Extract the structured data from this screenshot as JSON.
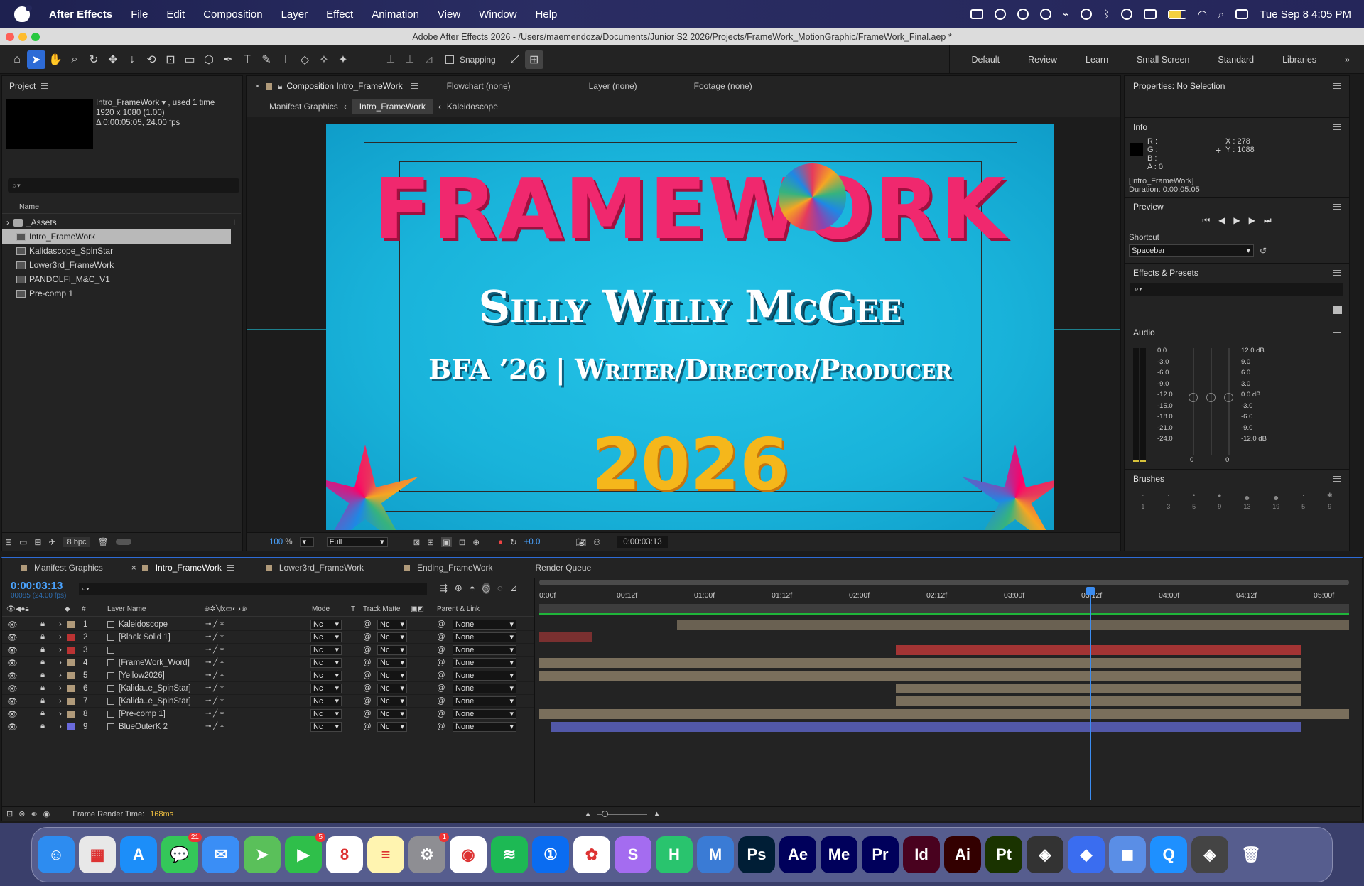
{
  "menubar": {
    "app_name": "After Effects",
    "menus": [
      "File",
      "Edit",
      "Composition",
      "Layer",
      "Effect",
      "Animation",
      "View",
      "Window",
      "Help"
    ],
    "clock": "Tue Sep 8  4:05 PM"
  },
  "titlebar": {
    "title": "Adobe After Effects 2026 - /Users/maemendoza/Documents/Junior S2 2026/Projects/FrameWork_MotionGraphic/FrameWork_Final.aep *"
  },
  "toolbar": {
    "snapping": "Snapping",
    "workspaces": [
      "Default",
      "Review",
      "Learn",
      "Small Screen",
      "Standard",
      "Libraries"
    ]
  },
  "project": {
    "title": "Project",
    "selected_name": "Intro_FrameWork ▾ , used 1 time",
    "selected_dims": "1920 x 1080 (1.00)",
    "selected_dur": "Δ 0:00:05:05, 24.00 fps",
    "col_name": "Name",
    "items": [
      {
        "name": "_Assets",
        "kind": "folder"
      },
      {
        "name": "Intro_FrameWork",
        "kind": "comp"
      },
      {
        "name": "Kalidascope_SpinStar",
        "kind": "comp"
      },
      {
        "name": "Lower3rd_FrameWork",
        "kind": "comp"
      },
      {
        "name": "PANDOLFI_M&C_V1",
        "kind": "comp"
      },
      {
        "name": "Pre-comp 1",
        "kind": "comp"
      }
    ],
    "bpc": "8 bpc"
  },
  "viewer": {
    "tab_comp": "Composition Intro_FrameWork",
    "tab_flowchart": "Flowchart (none)",
    "tab_layer": "Layer (none)",
    "tab_footage": "Footage (none)",
    "crumbs": [
      "Manifest Graphics",
      "Intro_FrameWork",
      "Kaleidoscope"
    ],
    "zoom": "100",
    "zoom_unit": "%",
    "resolution": "Full",
    "exposure": "+0.0",
    "timecode": "0:00:03:13",
    "canvas": {
      "title": "FRAMEWORK",
      "name": "Silly Willy McGee",
      "subtitle": "BFA ’26 | Writer/Director/Producer",
      "year": "2026"
    }
  },
  "right": {
    "properties": "Properties: No Selection",
    "info_title": "Info",
    "info_r": "R :",
    "info_g": "G :",
    "info_b": "B :",
    "info_a": "A :  0",
    "info_x": "X : 278",
    "info_y": "Y : 1088",
    "info_comp": "[Intro_FrameWork]",
    "info_dur": "Duration: 0:00:05:05",
    "preview_title": "Preview",
    "shortcut_label": "Shortcut",
    "shortcut_value": "Spacebar",
    "effects_title": "Effects & Presets",
    "audio_title": "Audio",
    "audio_left": [
      "0.0",
      "-3.0",
      "-6.0",
      "-9.0",
      "-12.0",
      "-15.0",
      "-18.0",
      "-21.0",
      "-24.0"
    ],
    "audio_right": [
      "12.0 dB",
      "9.0",
      "6.0",
      "3.0",
      "0.0 dB",
      "-3.0",
      "-6.0",
      "-9.0",
      "-12.0 dB"
    ],
    "audio_zero_a": "0",
    "audio_zero_b": "0",
    "brushes_title": "Brushes",
    "brush_sizes": [
      "1",
      "3",
      "5",
      "9",
      "13",
      "19",
      "5",
      "9"
    ]
  },
  "timeline": {
    "tabs": [
      "Manifest Graphics",
      "Intro_FrameWork",
      "Lower3rd_FrameWork",
      "Ending_FrameWork",
      "Render Queue"
    ],
    "timecode": "0:00:03:13",
    "frames": "00085 (24.00 fps)",
    "col_hash": "#",
    "col_layer": "Layer Name",
    "col_mode": "Mode",
    "col_t": "T",
    "col_matte": "Track Matte",
    "col_parent": "Parent & Link",
    "ruler": [
      "0:00f",
      "00:12f",
      "01:00f",
      "01:12f",
      "02:00f",
      "02:12f",
      "03:00f",
      "03:12f",
      "04:00f",
      "04:12f",
      "05:00f"
    ],
    "layers": [
      {
        "num": "1",
        "name": "Kaleidoscope",
        "color": "#b09a7a",
        "mode": "Nc",
        "matte": "Nc",
        "parent": "None",
        "start": 0.17,
        "end": 1.0,
        "bar": "#6a6152"
      },
      {
        "num": "2",
        "name": "[Black Solid 1]",
        "color": "#b33",
        "mode": "Nc",
        "matte": "Nc",
        "parent": "None",
        "start": 0.0,
        "end": 0.065,
        "bar": "#7a3030"
      },
      {
        "num": "3",
        "name": "",
        "color": "#b33",
        "mode": "Nc",
        "matte": "Nc",
        "parent": "None",
        "start": 0.44,
        "end": 0.94,
        "bar": "#a33434"
      },
      {
        "num": "4",
        "name": "[FrameWork_Word]",
        "color": "#b09a7a",
        "mode": "Nc",
        "matte": "Nc",
        "parent": "None",
        "start": 0.0,
        "end": 0.94,
        "bar": "#7a6f5c"
      },
      {
        "num": "5",
        "name": "[Yellow2026]",
        "color": "#b09a7a",
        "mode": "Nc",
        "matte": "Nc",
        "parent": "None",
        "start": 0.0,
        "end": 0.94,
        "bar": "#7a6f5c"
      },
      {
        "num": "6",
        "name": "[Kalida..e_SpinStar]",
        "color": "#b09a7a",
        "mode": "Nc",
        "matte": "Nc",
        "parent": "None",
        "start": 0.44,
        "end": 0.94,
        "bar": "#7a6f5c"
      },
      {
        "num": "7",
        "name": "[Kalida..e_SpinStar]",
        "color": "#b09a7a",
        "mode": "Nc",
        "matte": "Nc",
        "parent": "None",
        "start": 0.44,
        "end": 0.94,
        "bar": "#7a6f5c"
      },
      {
        "num": "8",
        "name": "[Pre-comp 1]",
        "color": "#b09a7a",
        "mode": "Nc",
        "matte": "Nc",
        "parent": "None",
        "start": 0.0,
        "end": 1.0,
        "bar": "#7a6f5c"
      },
      {
        "num": "9",
        "name": "BlueOuterK 2",
        "color": "#6a6adc",
        "mode": "Nc",
        "matte": "Nc",
        "parent": "None",
        "start": 0.015,
        "end": 0.94,
        "bar": "#5258a8"
      }
    ],
    "playhead": 0.68,
    "render_label": "Frame Render Time:",
    "render_value": "168ms"
  },
  "dock": {
    "apps": [
      {
        "name": "finder-icon",
        "glyph": "☺",
        "bg": "#2d8cf0"
      },
      {
        "name": "launchpad-icon",
        "glyph": "▦",
        "bg": "#e8e8e8"
      },
      {
        "name": "app-store-icon",
        "glyph": "A",
        "bg": "#1c8ef9"
      },
      {
        "name": "messages-icon",
        "glyph": "💬",
        "bg": "#34c759",
        "badge": "21"
      },
      {
        "name": "mail-icon",
        "glyph": "✉",
        "bg": "#3a8ef6"
      },
      {
        "name": "maps-icon",
        "glyph": "➤",
        "bg": "#5ac05a"
      },
      {
        "name": "facetime-icon",
        "glyph": "▶",
        "bg": "#2fbf4a",
        "badge": "5"
      },
      {
        "name": "calendar-icon",
        "glyph": "8",
        "bg": "#ffffff"
      },
      {
        "name": "notes-icon",
        "glyph": "≡",
        "bg": "#fff4b0"
      },
      {
        "name": "settings-icon",
        "glyph": "⚙",
        "bg": "#8e8e93",
        "badge": "1"
      },
      {
        "name": "chrome-icon",
        "glyph": "◉",
        "bg": "#ffffff"
      },
      {
        "name": "spotify-icon",
        "glyph": "≋",
        "bg": "#1db954"
      },
      {
        "name": "onepassword-icon",
        "glyph": "①",
        "bg": "#0a6cf1"
      },
      {
        "name": "photos-icon",
        "glyph": "✿",
        "bg": "#ffffff"
      },
      {
        "name": "s-app-icon",
        "glyph": "S",
        "bg": "#a46cf0"
      },
      {
        "name": "h-app-icon",
        "glyph": "H",
        "bg": "#29c46e"
      },
      {
        "name": "m-app-icon",
        "glyph": "M",
        "bg": "#3a7bd5"
      },
      {
        "name": "photoshop-icon",
        "glyph": "Ps",
        "bg": "#001e36"
      },
      {
        "name": "after-effects-icon",
        "glyph": "Ae",
        "bg": "#00005b"
      },
      {
        "name": "media-encoder-icon",
        "glyph": "Me",
        "bg": "#00005b"
      },
      {
        "name": "premiere-icon",
        "glyph": "Pr",
        "bg": "#00005b"
      },
      {
        "name": "indesign-icon",
        "glyph": "Id",
        "bg": "#49021f"
      },
      {
        "name": "illustrator-icon",
        "glyph": "Ai",
        "bg": "#330000"
      },
      {
        "name": "substance-painter-icon",
        "glyph": "Pt",
        "bg": "#1a3300"
      },
      {
        "name": "davinci-icon",
        "glyph": "◈",
        "bg": "#333"
      },
      {
        "name": "roblox-icon",
        "glyph": "◆",
        "bg": "#3a6df0"
      },
      {
        "name": "finder-drive-icon",
        "glyph": "◼",
        "bg": "#5a8ee6"
      },
      {
        "name": "quicktime-icon",
        "glyph": "Q",
        "bg": "#1e90ff"
      },
      {
        "name": "davinci2-icon",
        "glyph": "◈",
        "bg": "#444"
      },
      {
        "name": "trash-icon",
        "glyph": "🗑",
        "bg": "transparent"
      }
    ]
  }
}
